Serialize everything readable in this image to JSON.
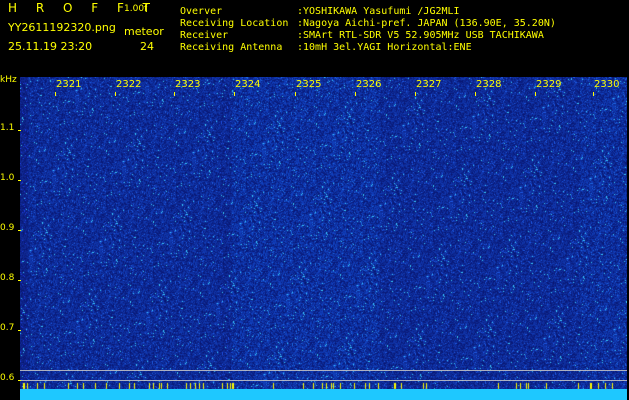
{
  "header": {
    "brand": "H R O F F T",
    "version": "1.00f",
    "filename": "YY2611192320.png",
    "datetime": "25.11.19 23:20",
    "meteor_label": "meteor",
    "meteor_count": "24"
  },
  "info": [
    {
      "key": "Overver",
      "value": ":YOSHIKAWA Yasufumi /JG2MLI"
    },
    {
      "key": "Receiving Location",
      "value": ":Nagoya Aichi-pref. JAPAN (136.90E, 35.20N)"
    },
    {
      "key": "Receiver",
      "value": ":SMArt RTL-SDR V5 52.905MHz USB TACHIKAWA"
    },
    {
      "key": "Receiving Antenna",
      "value": ":10mH 3el.YAGI Horizontal:ENE"
    }
  ],
  "spectrogram": {
    "y_unit": "kHz",
    "y_ticks": [
      "1.1",
      "1.0",
      "0.9",
      "0.8",
      "0.7",
      "0.6"
    ],
    "x_ticks": [
      "2321",
      "2322",
      "2323",
      "2324",
      "2325",
      "2326",
      "2327",
      "2328",
      "2329",
      "2330"
    ],
    "colors": {
      "background": "#000000",
      "text": "#ffff00",
      "noise_base": "#0a1a8a",
      "noise_hot": "#3cd2ff",
      "baseline": "#1ec8ff"
    }
  }
}
